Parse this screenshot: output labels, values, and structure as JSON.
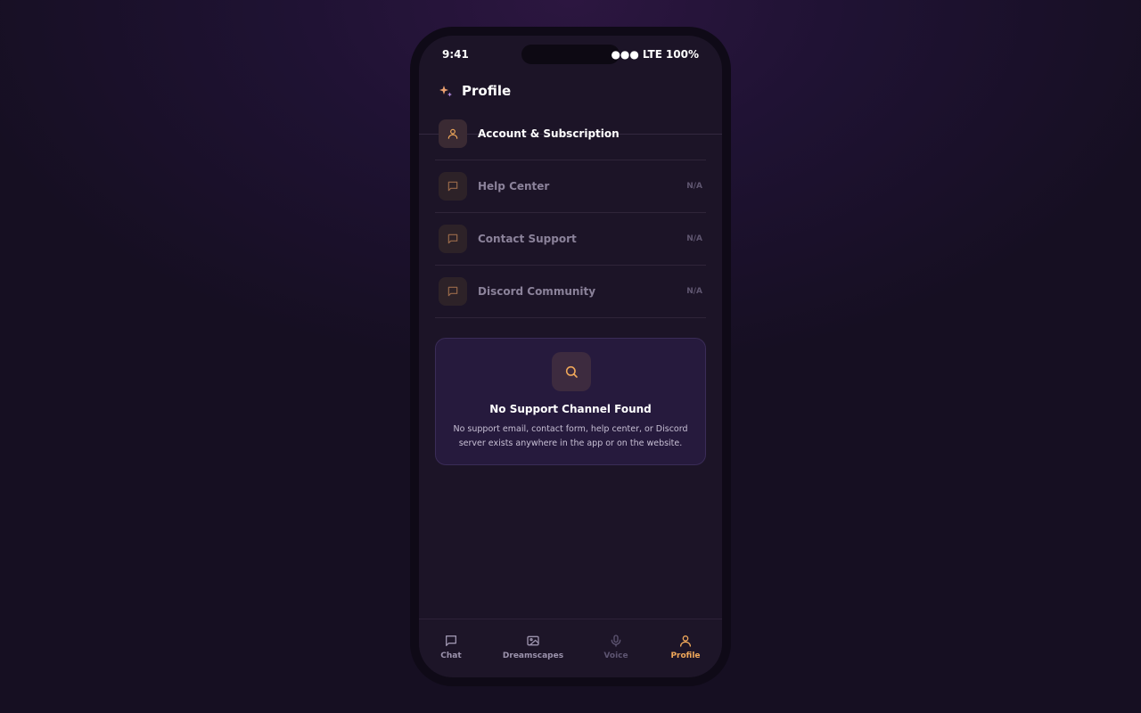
{
  "status_bar": {
    "time": "9:41",
    "signal": "●●●",
    "network": "LTE",
    "battery": "100%"
  },
  "header": {
    "title": "Profile",
    "logo_icon": "sparkle-logo-icon"
  },
  "menu": [
    {
      "label": "Account & Subscription",
      "value": "",
      "icon": "user-icon",
      "enabled": true
    },
    {
      "label": "Help Center",
      "value": "N/A",
      "icon": "message-square-icon",
      "enabled": false
    },
    {
      "label": "Contact Support",
      "value": "N/A",
      "icon": "message-square-icon",
      "enabled": false
    },
    {
      "label": "Discord Community",
      "value": "N/A",
      "icon": "message-square-icon",
      "enabled": false
    }
  ],
  "notice": {
    "icon": "search-icon",
    "title": "No Support Channel Found",
    "text": "No support email, contact form, help center, or Discord server exists anywhere in the app or on the website."
  },
  "nav": [
    {
      "label": "Chat",
      "icon": "chat-icon",
      "state": "normal"
    },
    {
      "label": "Dreamscapes",
      "icon": "image-icon",
      "state": "normal"
    },
    {
      "label": "Voice",
      "icon": "microphone-icon",
      "state": "disabled"
    },
    {
      "label": "Profile",
      "icon": "user-icon",
      "state": "active"
    }
  ],
  "colors": {
    "accent": "#f0a85a",
    "background": "#1c1427",
    "card": "#261a3d",
    "muted_text": "#8b829a"
  }
}
